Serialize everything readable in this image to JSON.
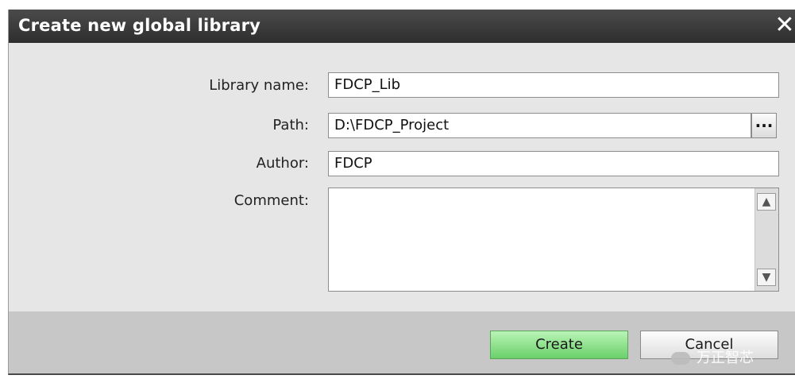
{
  "dialog": {
    "title": "Create new global library",
    "close_glyph": "✕"
  },
  "form": {
    "library_name": {
      "label": "Library name:",
      "value": "FDCP_Lib"
    },
    "path": {
      "label": "Path:",
      "value": "D:\\FDCP_Project",
      "browse_label": "..."
    },
    "author": {
      "label": "Author:",
      "value": "FDCP"
    },
    "comment": {
      "label": "Comment:",
      "value": ""
    }
  },
  "scroll": {
    "up_glyph": "▲",
    "down_glyph": "▼"
  },
  "buttons": {
    "create": "Create",
    "cancel": "Cancel"
  },
  "watermark": {
    "text": "万正智芯"
  },
  "colors": {
    "title_bg": "#3a3a3a",
    "dialog_bg": "#e6e6e6",
    "footer_bg": "#c7c7c7",
    "create_accent": "#7fdc7a"
  }
}
